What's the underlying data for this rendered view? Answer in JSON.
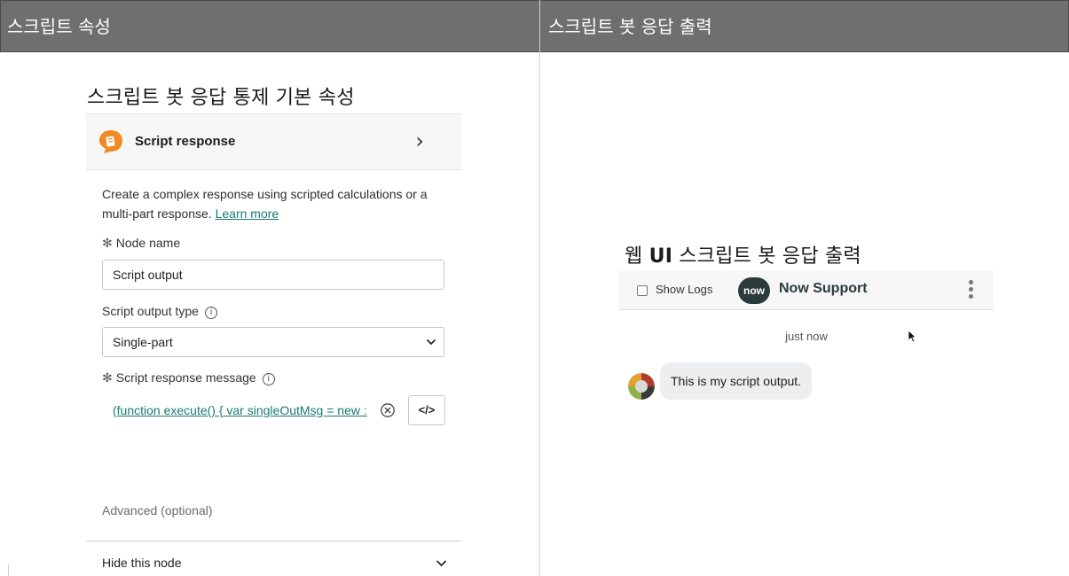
{
  "left_column": {
    "header": "스크립트 속성",
    "caption": "스크립트 봇 응답 통제 기본 속성",
    "panel": {
      "title": "Script response",
      "description": "Create a complex response using scripted calculations or a multi-part response.",
      "learn_more": "Learn more",
      "node_name_label": "Node name",
      "node_name_value": "Script output",
      "output_type_label": "Script output type",
      "output_type_value": "Single-part",
      "message_label": "Script response message",
      "message_value": "(function execute() { var singleOutMsg = new :",
      "code_button": "</>",
      "advanced": "Advanced (optional)",
      "hide_node": "Hide this node"
    }
  },
  "right_column": {
    "header": "스크립트 봇 응답 출력",
    "caption_bold": "UI",
    "caption_prefix": "웹 ",
    "caption_suffix": " 스크립트 봇 응답 출력",
    "chat": {
      "show_logs": "Show Logs",
      "logo_text": "now",
      "bot_name": "Now Support",
      "timestamp": "just now",
      "message": "This is my script output."
    }
  },
  "colors": {
    "header_bg": "#6f6f6f",
    "link": "#1a7a72",
    "script_icon": "#f08a24",
    "now_logo_bg": "#2b3a3b"
  }
}
